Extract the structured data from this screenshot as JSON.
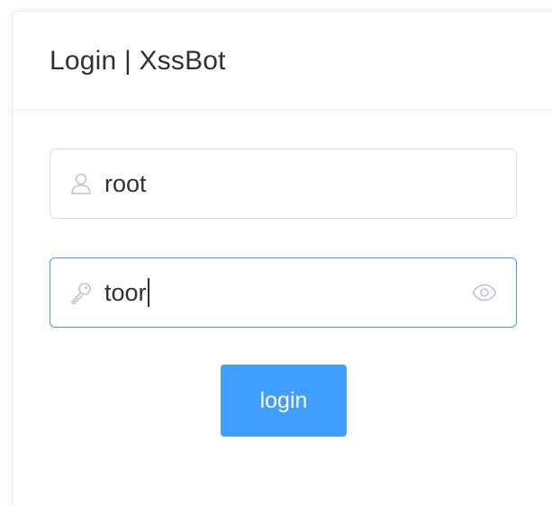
{
  "card": {
    "title": "Login | XssBot"
  },
  "username": {
    "value": "root",
    "icon": "user-icon"
  },
  "password": {
    "value": "toor",
    "icon": "key-icon",
    "toggle_icon": "eye-icon"
  },
  "login_button": {
    "label": "login"
  },
  "colors": {
    "primary": "#409eff",
    "border": "#dcdfe6",
    "divider": "#ebeef5",
    "text": "#303133",
    "icon": "#c0c4cc"
  }
}
